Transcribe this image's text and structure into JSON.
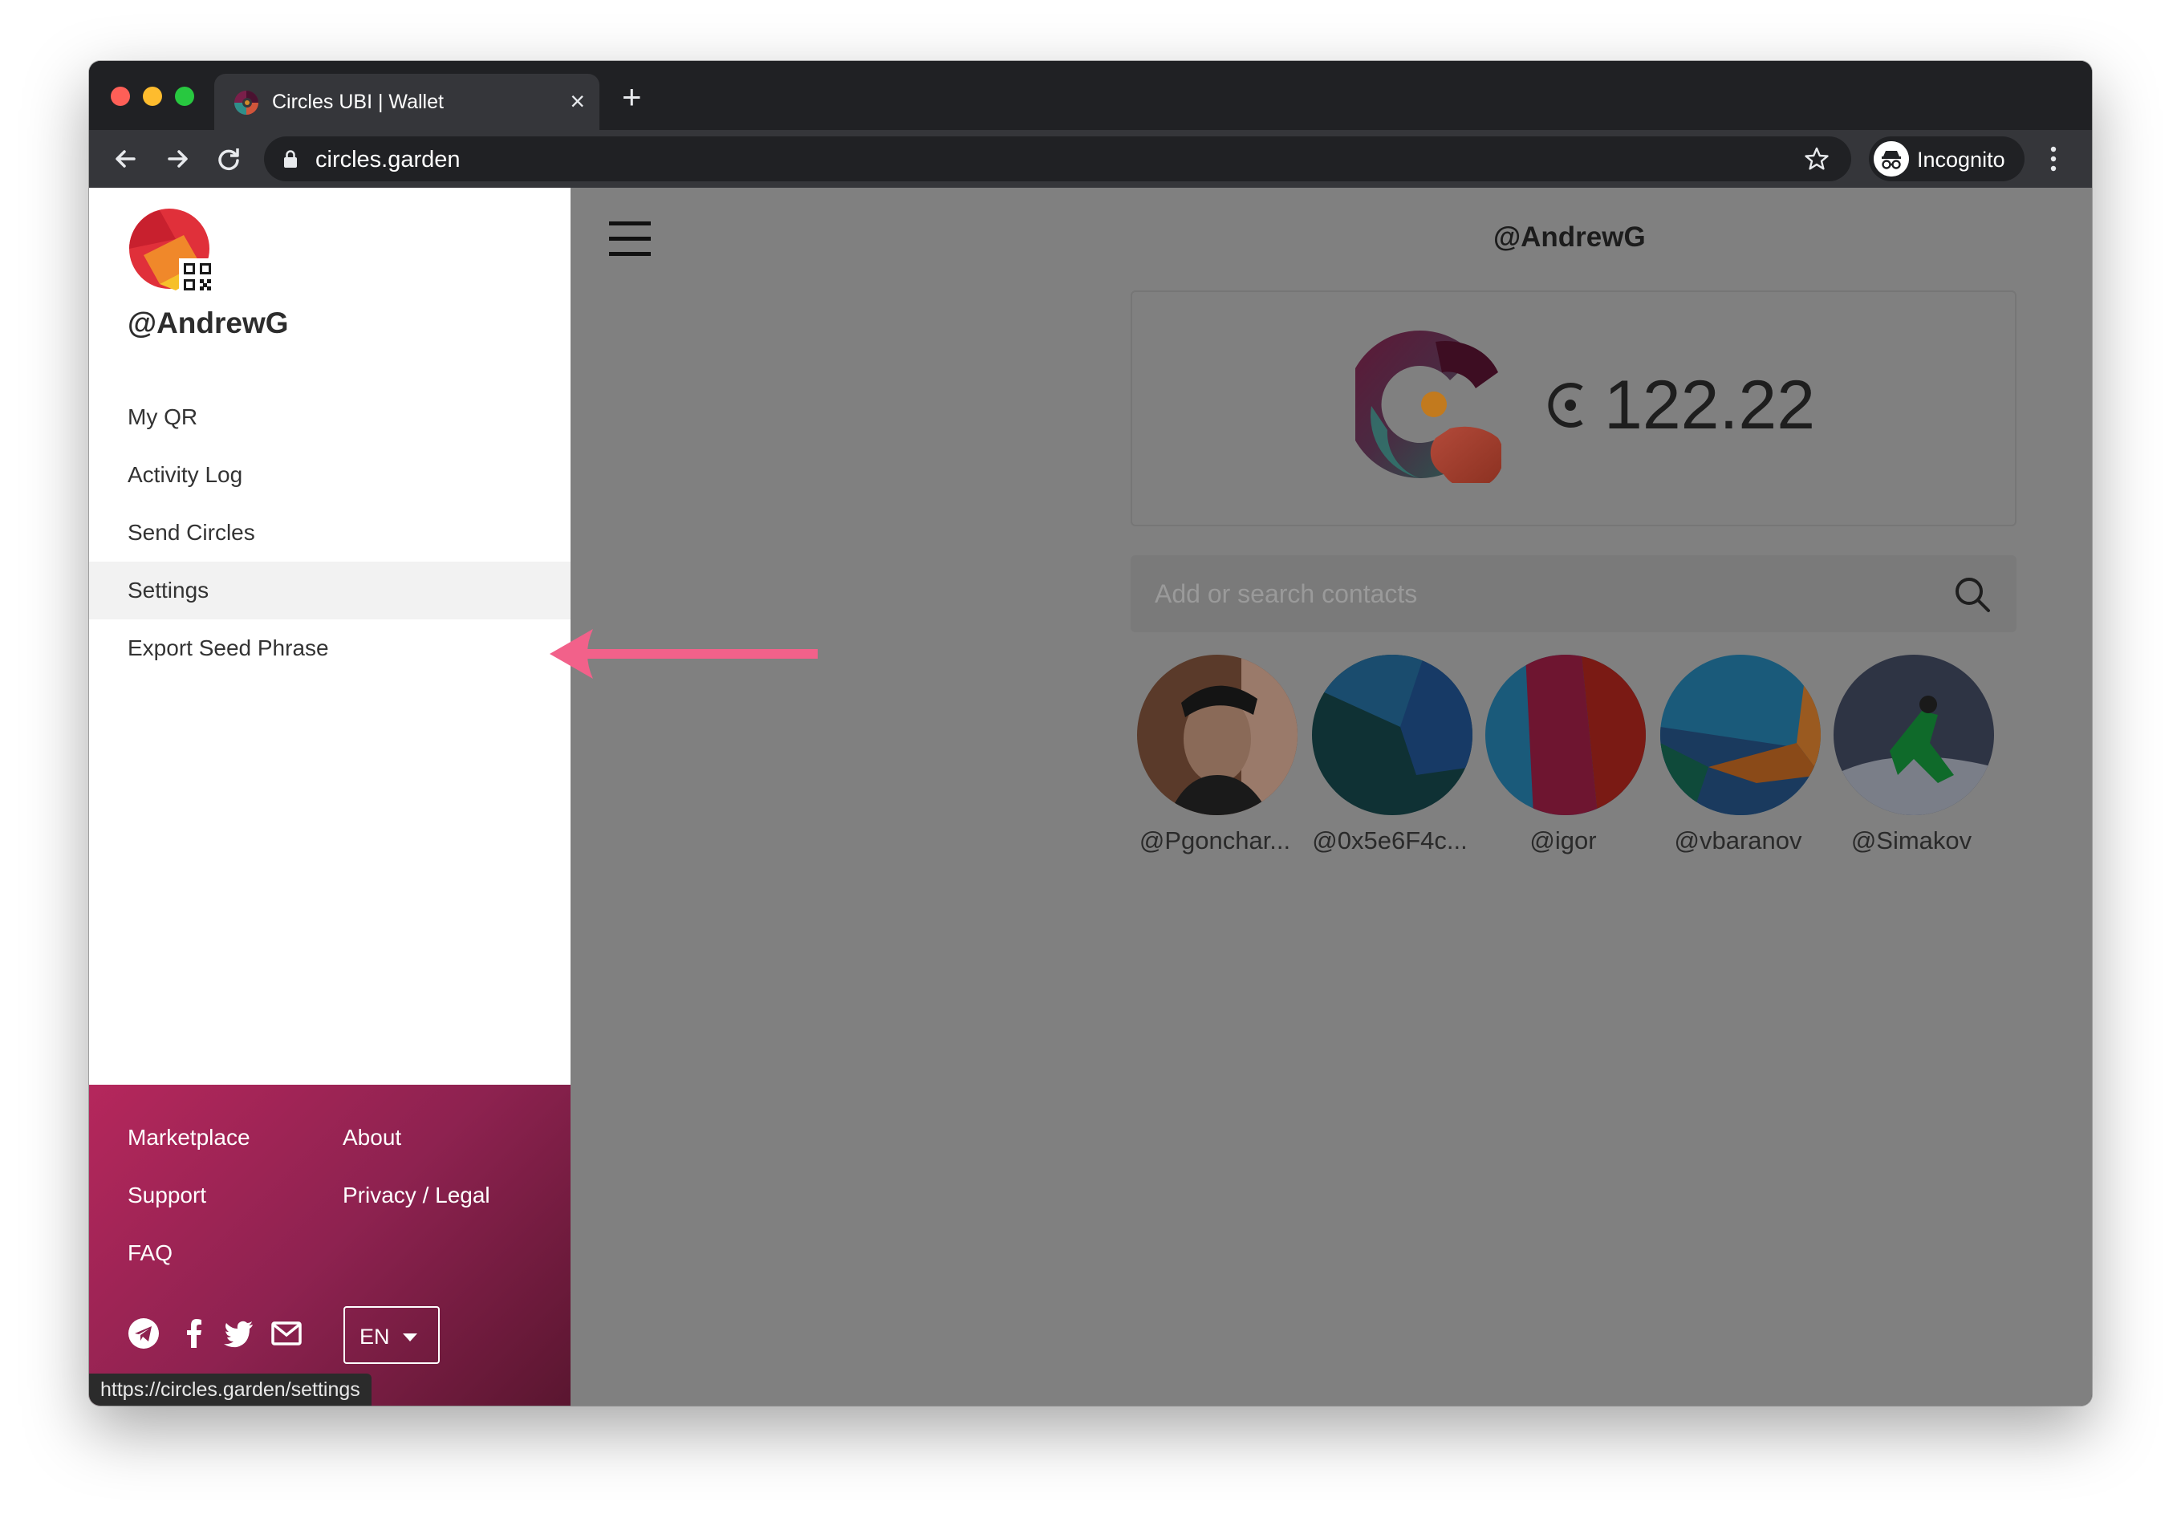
{
  "browser": {
    "tab_title": "Circles UBI | Wallet",
    "tab_close": "×",
    "new_tab": "+",
    "url": "circles.garden",
    "profile_label": "Incognito"
  },
  "sidebar": {
    "username": "@AndrewG",
    "menu": [
      {
        "label": "My QR"
      },
      {
        "label": "Activity Log"
      },
      {
        "label": "Send Circles"
      },
      {
        "label": "Settings",
        "active": true
      },
      {
        "label": "Export Seed Phrase"
      }
    ],
    "footer_links": {
      "marketplace": "Marketplace",
      "about": "About",
      "support": "Support",
      "privacy": "Privacy / Legal",
      "faq": "FAQ"
    },
    "social_icons": [
      "telegram-icon",
      "facebook-icon",
      "twitter-icon",
      "mail-icon"
    ],
    "language": "EN",
    "status_url": "https://circles.garden/settings"
  },
  "main": {
    "username": "@AndrewG",
    "balance": "122.22",
    "search_placeholder": "Add or search contacts",
    "contacts": [
      {
        "name": "@Pgonchar..."
      },
      {
        "name": "@0x5e6F4c..."
      },
      {
        "name": "@igor"
      },
      {
        "name": "@vbaranov"
      },
      {
        "name": "@Simakov"
      }
    ]
  },
  "colors": {
    "overlay": "#808080",
    "footer_gradient_start": "#b5275c",
    "footer_gradient_end": "#5a1630",
    "annotation_arrow": "#f2618a"
  }
}
